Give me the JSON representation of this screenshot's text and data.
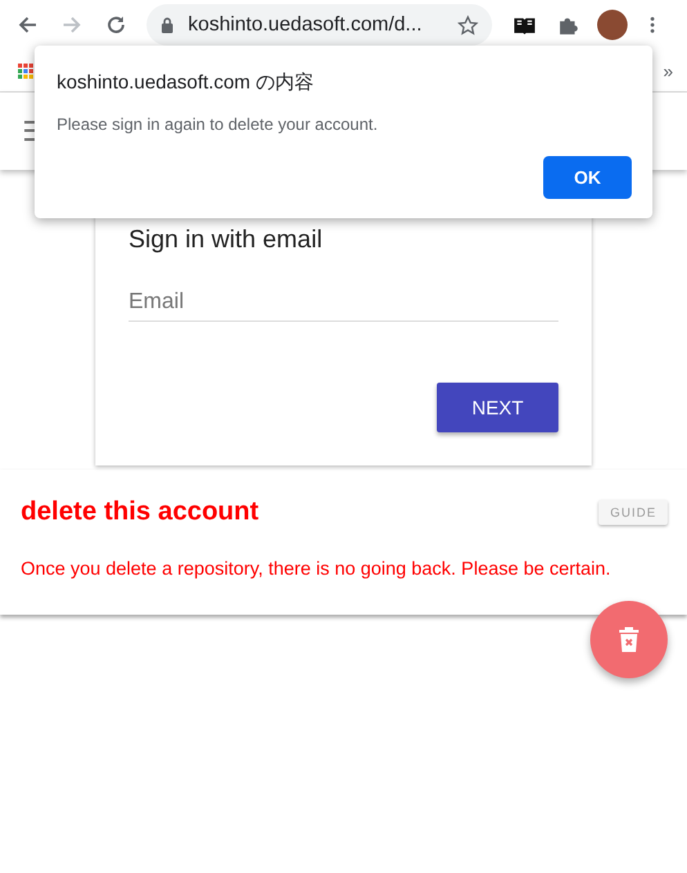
{
  "browser": {
    "url": "koshinto.uedasoft.com/d...",
    "forward_disabled": true,
    "bookmarks_more": "»"
  },
  "app_bar": {
    "menu": "☰"
  },
  "sign_in": {
    "title": "Sign in with email",
    "email_placeholder": "Email",
    "next": "NEXT"
  },
  "danger": {
    "title": "delete this account",
    "guide": "GUIDE",
    "message": "Once you delete a repository, there is no going back. Please be certain."
  },
  "dialog": {
    "title": "koshinto.uedasoft.com の内容",
    "message": "Please sign in again to delete your account.",
    "ok": "OK"
  }
}
